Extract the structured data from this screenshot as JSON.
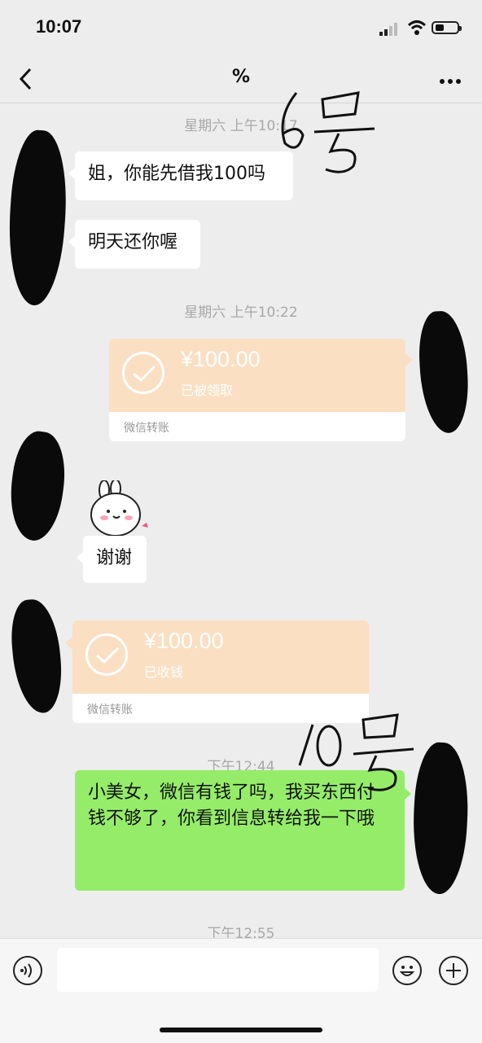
{
  "status_bar": {
    "time": "10:07"
  },
  "nav": {
    "back_icon": "chevron-left-icon",
    "title": "%",
    "more_icon": "more-dots-icon"
  },
  "messages": {
    "ts1": "星期六 上午10:17",
    "m1": "姐，你能先借我100吗",
    "m2": "明天还你喔",
    "ts2": "星期六 上午10:22",
    "transfer1": {
      "amount": "¥100.00",
      "status": "已被领取",
      "footer": "微信转账"
    },
    "m3": "谢谢",
    "transfer2": {
      "amount": "¥100.00",
      "status": "已收钱",
      "footer": "微信转账"
    },
    "ts3": "下午12:44",
    "m4": "小美女，微信有钱了吗，我买东西付钱不够了，你看到信息转给我一下哦",
    "ts4": "下午12:55"
  },
  "annotations": {
    "a1": "6号",
    "a2": "10号"
  },
  "input_bar": {
    "voice_icon": "voice-icon",
    "emoji_icon": "emoji-icon",
    "add_icon": "plus-icon"
  },
  "colors": {
    "background": "#ededed",
    "sent_bubble": "#95ec69",
    "transfer_card": "#fadfc3"
  }
}
